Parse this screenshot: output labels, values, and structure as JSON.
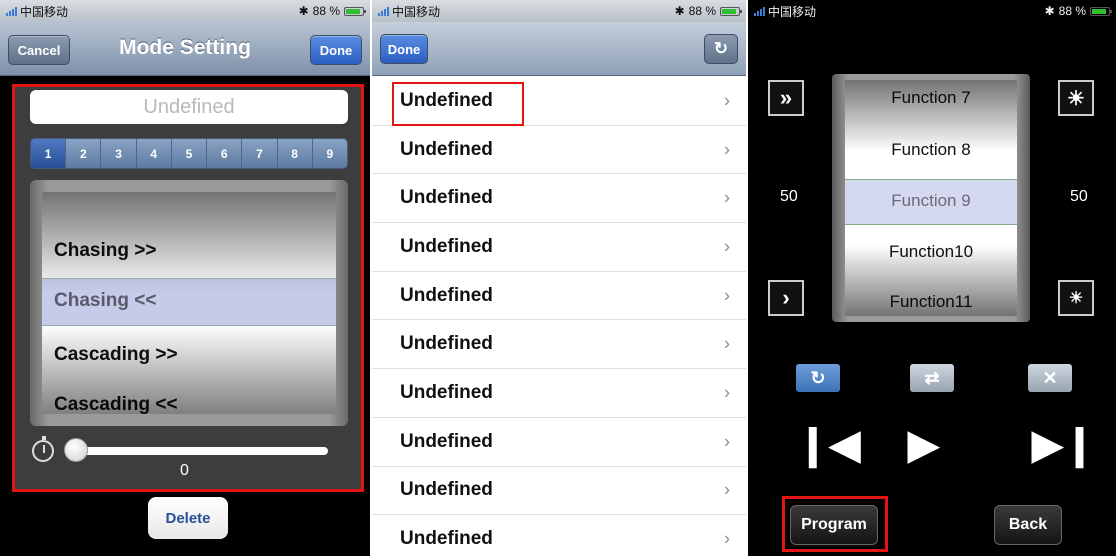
{
  "status_bar": {
    "carrier": "中国移动",
    "battery": "88 %",
    "bluetooth_icon": "bluetooth-icon",
    "battery_icon": "battery-icon"
  },
  "mode_setting": {
    "title": "Mode Setting",
    "cancel_label": "Cancel",
    "done_label": "Done",
    "name_placeholder": "Undefined",
    "segments": [
      "1",
      "2",
      "3",
      "4",
      "5",
      "6",
      "7",
      "8",
      "9"
    ],
    "selected_segment": "1",
    "picker_items": [
      "Chasing >>",
      "Chasing <<",
      "Cascading >>",
      "Cascading <<"
    ],
    "selected_item": "Chasing <<",
    "speed_value": "0",
    "delete_label": "Delete"
  },
  "mode_list": {
    "done_label": "Done",
    "refresh_icon": "refresh-icon",
    "rows": [
      "Undefined",
      "Undefined",
      "Undefined",
      "Undefined",
      "Undefined",
      "Undefined",
      "Undefined",
      "Undefined",
      "Undefined",
      "Undefined"
    ]
  },
  "player": {
    "left_value": "50",
    "right_value": "50",
    "functions": [
      "Function 7",
      "Function 8",
      "Function 9",
      "Function10",
      "Function11"
    ],
    "selected_function": "Function 9",
    "program_label": "Program",
    "back_label": "Back"
  },
  "colors": {
    "highlight_red": "#e21414",
    "nav_blue": "#2a5fc2"
  }
}
